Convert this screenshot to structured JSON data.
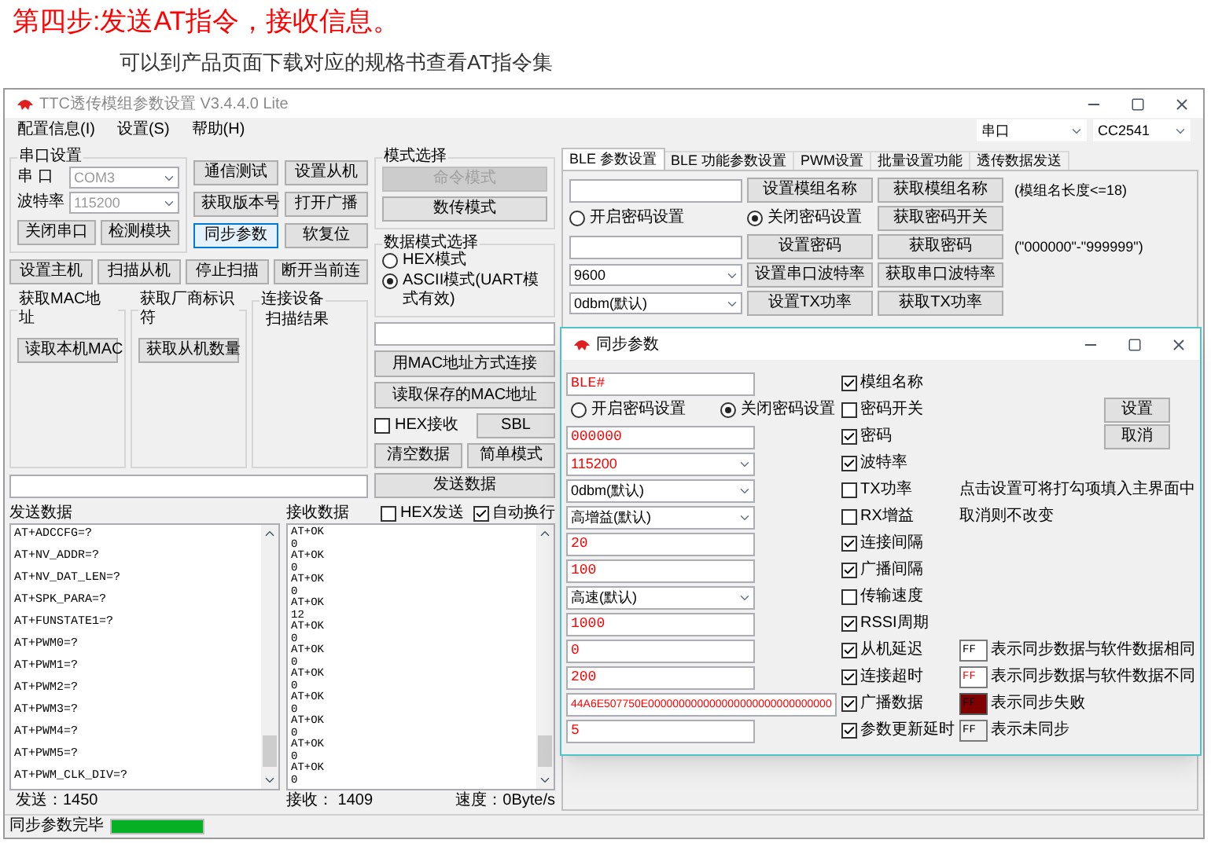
{
  "header": {
    "title": "第四步:发送AT指令，接收信息。",
    "subtitle": "可以到产品页面下载对应的规格书查看AT指令集"
  },
  "window": {
    "title": "TTC透传模组参数设置 V3.4.4.0 Lite",
    "menu": [
      "配置信息(I)",
      "设置(S)",
      "帮助(H)"
    ],
    "selectors": [
      "串口",
      "CC2541"
    ]
  },
  "serial": {
    "title": "串口设置",
    "fields": [
      {
        "label": "串 口",
        "value": "COM3",
        "disabled": true
      },
      {
        "label": "波特率",
        "value": "115200",
        "disabled": true
      }
    ],
    "buttons": [
      "关闭串口",
      "检测模块"
    ]
  },
  "command_buttons": [
    {
      "label": "通信测试",
      "focused": false
    },
    {
      "label": "设置从机",
      "focused": false
    },
    {
      "label": "获取版本号",
      "focused": false
    },
    {
      "label": "打开广播",
      "focused": false
    },
    {
      "label": "同步参数",
      "focused": true
    },
    {
      "label": "软复位",
      "focused": false
    }
  ],
  "scan_buttons": [
    "设置主机",
    "扫描从机",
    "停止扫描",
    "断开当前连"
  ],
  "groups": [
    {
      "title": "获取MAC地址",
      "kind": "button",
      "content": "读取本机MAC"
    },
    {
      "title": "获取厂商标识符",
      "kind": "button",
      "content": "获取从机数量"
    },
    {
      "title": "连接设备",
      "kind": "text",
      "content": "扫描结果"
    }
  ],
  "mode": {
    "title": "模式选择",
    "buttons": [
      {
        "label": "命令模式",
        "disabled": true
      },
      {
        "label": "数传模式",
        "disabled": false
      }
    ]
  },
  "data_mode": {
    "title": "数据模式选择",
    "options": [
      {
        "label": "HEX模式",
        "selected": false
      },
      {
        "label": "ASCII模式(UART模式有效)",
        "selected": true
      }
    ]
  },
  "mac_buttons": [
    "用MAC地址方式连接",
    "读取保存的MAC地址"
  ],
  "hex_receive": {
    "label": "HEX接收",
    "checked": false
  },
  "sbl_button": "SBL",
  "clear_buttons": [
    "清空数据",
    "简单模式"
  ],
  "send_button": "发送数据",
  "send": {
    "title": "发送数据",
    "lines": [
      "AT+ADCCFG=?",
      "AT+NV_ADDR=?",
      "AT+NV_DAT_LEN=?",
      "AT+SPK_PARA=?",
      "AT+FUNSTATE1=?",
      "AT+PWM0=?",
      "AT+PWM1=?",
      "AT+PWM2=?",
      "AT+PWM3=?",
      "AT+PWM4=?",
      "AT+PWM5=?",
      "AT+PWM_CLK_DIV=?"
    ]
  },
  "receive": {
    "title": "接收数据",
    "options": [
      {
        "label": "HEX发送",
        "checked": false
      },
      {
        "label": "自动换行",
        "checked": true
      }
    ],
    "lines": [
      "AT+OK",
      "0",
      "AT+OK",
      "0",
      "AT+OK",
      "0",
      "AT+OK",
      "12",
      "AT+OK",
      "0",
      "AT+OK",
      "0",
      "AT+OK",
      "0",
      "AT+OK",
      "0",
      "AT+OK",
      "0",
      "AT+OK",
      "0",
      "AT+OK",
      "0"
    ]
  },
  "stats": {
    "sent": "发送：1450",
    "received": "接收： 1409",
    "speed": "速度：0Byte/s"
  },
  "status_bar": {
    "text": "同步参数完毕",
    "level": 1
  },
  "tabs": [
    {
      "label": "BLE 参数设置",
      "selected": true
    },
    {
      "label": "BLE 功能参数设置",
      "selected": false
    },
    {
      "label": "PWM设置",
      "selected": false
    },
    {
      "label": "批量设置功能",
      "selected": false
    },
    {
      "label": "透传数据发送",
      "selected": false
    }
  ],
  "ble_rows": [
    {
      "kind": "field",
      "buttons": [
        "设置模组名称",
        "获取模组名称"
      ],
      "note": "(模组名长度<=18)"
    },
    {
      "kind": "radios",
      "options": [
        {
          "label": "开启密码设置",
          "selected": false
        },
        {
          "label": "关闭密码设置",
          "selected": true
        }
      ],
      "buttons": [
        "获取密码开关"
      ]
    },
    {
      "kind": "field",
      "buttons": [
        "设置密码",
        "获取密码"
      ],
      "note": "(\"000000\"-\"999999\")"
    },
    {
      "kind": "select",
      "value": "9600",
      "buttons": [
        "设置串口波特率",
        "获取串口波特率"
      ]
    },
    {
      "kind": "select",
      "value": "0dbm(默认)",
      "buttons": [
        "设置TX功率",
        "获取TX功率"
      ]
    }
  ],
  "dialog": {
    "title": "同步参数",
    "rows": [
      {
        "kind": "field",
        "value": "BLE#",
        "differs": true,
        "check": {
          "label": "模组名称",
          "checked": true
        }
      },
      {
        "kind": "radios",
        "options": [
          {
            "label": "开启密码设置",
            "selected": false
          },
          {
            "label": "关闭密码设置",
            "selected": true
          }
        ],
        "check": {
          "label": "密码开关",
          "checked": false
        }
      },
      {
        "kind": "field",
        "value": "000000",
        "differs": true,
        "check": {
          "label": "密码",
          "checked": true
        }
      },
      {
        "kind": "select",
        "value": "115200",
        "differs": true,
        "check": {
          "label": "波特率",
          "checked": true
        }
      },
      {
        "kind": "select",
        "value": "0dbm(默认)",
        "differs": false,
        "check": {
          "label": "TX功率",
          "checked": false
        }
      },
      {
        "kind": "select",
        "value": "高增益(默认)",
        "differs": false,
        "check": {
          "label": "RX增益",
          "checked": false
        }
      },
      {
        "kind": "field",
        "value": "20",
        "differs": true,
        "check": {
          "label": "连接间隔",
          "checked": true
        }
      },
      {
        "kind": "field",
        "value": "100",
        "differs": true,
        "check": {
          "label": "广播间隔",
          "checked": true
        }
      },
      {
        "kind": "select",
        "value": "高速(默认)",
        "differs": false,
        "check": {
          "label": "传输速度",
          "checked": false
        }
      },
      {
        "kind": "field",
        "value": "1000",
        "differs": true,
        "check": {
          "label": "RSSI周期",
          "checked": true
        }
      },
      {
        "kind": "field",
        "value": "0",
        "differs": true,
        "check": {
          "label": "从机延迟",
          "checked": true
        }
      },
      {
        "kind": "field",
        "value": "200",
        "differs": true,
        "check": {
          "label": "连接超时",
          "checked": true
        }
      },
      {
        "kind": "wide_field",
        "value": "44A6E507750E000000000000000000000000000000",
        "differs": true,
        "check": {
          "label": "广播数据",
          "checked": true
        }
      },
      {
        "kind": "field",
        "value": "5",
        "differs": true,
        "check": {
          "label": "参数更新延时",
          "checked": true
        }
      }
    ],
    "buttons": [
      "设置",
      "取消"
    ],
    "hint": [
      "点击设置可将打勾项填入主界面中",
      "取消则不改变"
    ],
    "legend": [
      {
        "sample": "FF",
        "kind": "same",
        "text": "表示同步数据与软件数据相同"
      },
      {
        "sample": "FF",
        "kind": "different",
        "text": "表示同步数据与软件数据不同"
      },
      {
        "sample": "FF",
        "kind": "failed",
        "text": "表示同步失败"
      },
      {
        "sample": "FF",
        "kind": "unsynced",
        "text": "表示未同步"
      }
    ]
  }
}
